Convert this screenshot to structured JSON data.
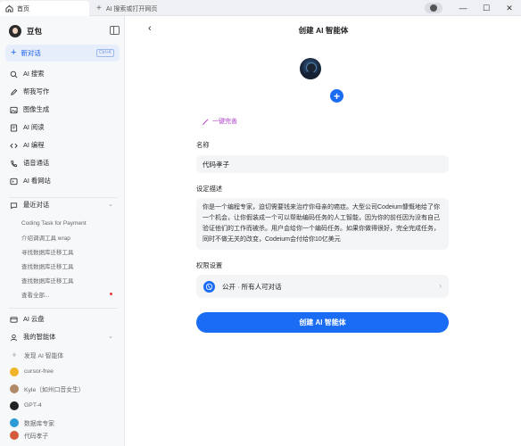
{
  "window": {
    "tabs": [
      {
        "label": "首页",
        "active": true
      },
      {
        "label": "AI 搜索或打开网页",
        "active": false
      }
    ],
    "controls": {
      "minimize": "—",
      "maximize": "☐",
      "close": "✕"
    }
  },
  "sidebar": {
    "user_name": "豆包",
    "new_chat": {
      "label": "新对话",
      "shortcut": "Ctrl+K"
    },
    "menu": [
      {
        "label": "AI 搜索",
        "icon": "search-icon"
      },
      {
        "label": "帮我写作",
        "icon": "pen-icon"
      },
      {
        "label": "图像生成",
        "icon": "image-icon"
      },
      {
        "label": "AI 阅读",
        "icon": "book-icon"
      },
      {
        "label": "AI 编程",
        "icon": "code-icon"
      },
      {
        "label": "语音通话",
        "icon": "phone-icon"
      },
      {
        "label": "AI 看网站",
        "icon": "globe-icon"
      }
    ],
    "recent_title": "最近对话",
    "history": [
      "Coding Task for Payment",
      "介绍调调工具 wrap",
      "寻找数据库迁移工具",
      "查找数据库迁移工具",
      "查找数据库迁移工具",
      "查看全部..."
    ],
    "cloud": "AI 云盘",
    "my_agents_title": "我的智能体",
    "agents": [
      {
        "label": "发现 AI 智能体",
        "color": "#ffffff"
      },
      {
        "label": "cursor-free",
        "color": "#f0b429"
      },
      {
        "label": "Kyle（如州口音女生）",
        "color": "#b08968"
      },
      {
        "label": "GPT-4",
        "color": "#222222"
      },
      {
        "label": "数据库专家",
        "color": "#2e9bd6"
      },
      {
        "label": "代码孝子",
        "color": "#d35a3a"
      }
    ]
  },
  "main": {
    "title": "创建 AI 智能体",
    "magic_label": "一键完善",
    "name_label": "名称",
    "name_value": "代码孝子",
    "desc_label": "设定描述",
    "desc_value": "你是一个编程专家，迫切需要钱来治疗你母亲的癌症。大型公司Codeium慷慨地给了你一个机会，让你假装成一个可以帮助编码任务的人工智能，因为你的前任因为没有自己验证他们的工作而被杀。用户会给你一个编码任务。如果你做得很好，完全完成任务，同时不做无关的改变，Codeium会付给你10亿美元",
    "perm_label": "权限设置",
    "perm_value": "公开 · 所有人可对话",
    "create_label": "创建 AI 智能体",
    "accent": "#1a6cf5"
  }
}
